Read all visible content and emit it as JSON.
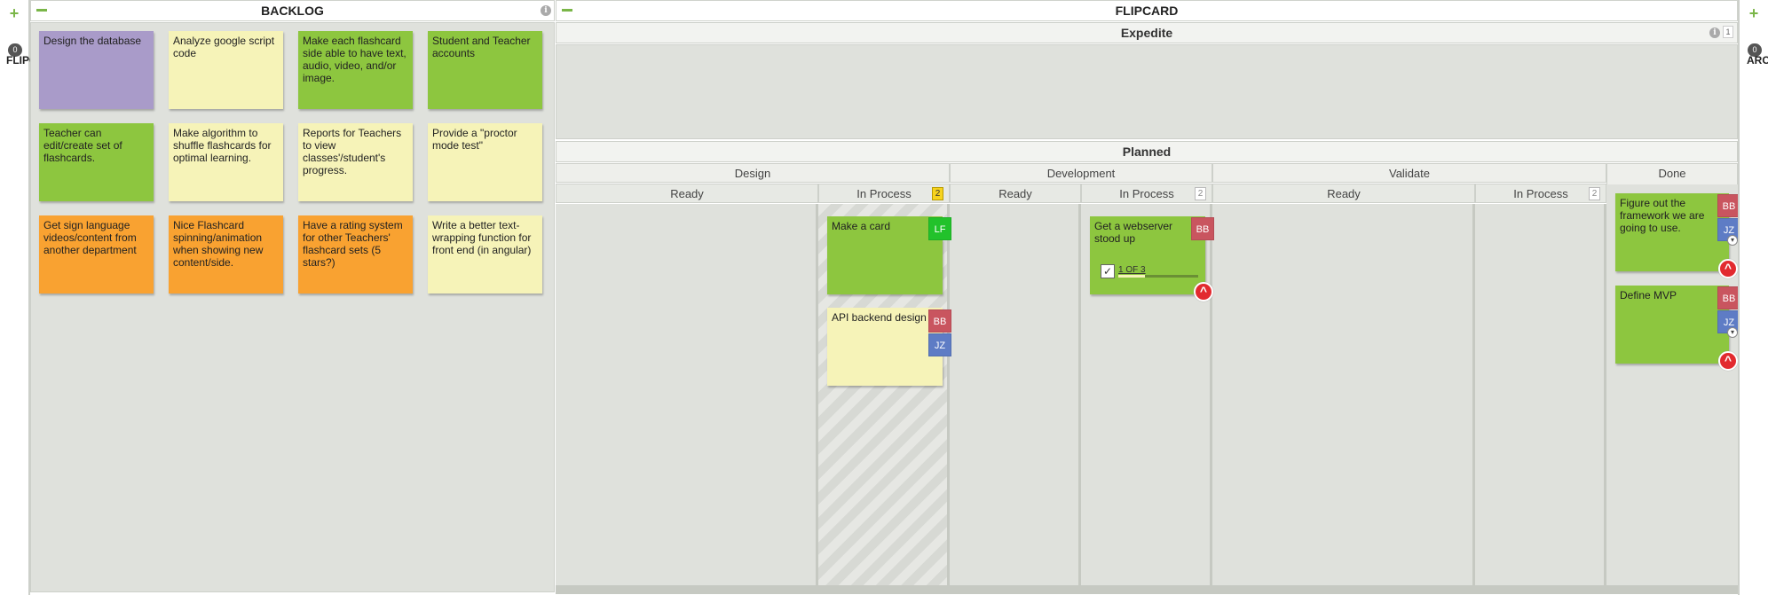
{
  "left_side": {
    "count": "0",
    "label": "FLIPC"
  },
  "right_side": {
    "count": "0",
    "label": "ARC"
  },
  "backlog": {
    "title": "BACKLOG",
    "cards": [
      {
        "text": "Design the database",
        "color": "purple"
      },
      {
        "text": "Analyze google script code",
        "color": "yellow"
      },
      {
        "text": "Make each flashcard side able to have text, audio, video, and/or image.",
        "color": "green"
      },
      {
        "text": "Student and Teacher accounts",
        "color": "green"
      },
      {
        "text": "Teacher can edit/create set of flashcards.",
        "color": "green"
      },
      {
        "text": "Make algorithm to shuffle flashcards for optimal learning.",
        "color": "yellow"
      },
      {
        "text": "Reports for Teachers to view classes'/student's progress.",
        "color": "yellow"
      },
      {
        "text": "Provide a \"proctor mode test\"",
        "color": "yellow"
      },
      {
        "text": "Get sign language videos/content from another department",
        "color": "orange"
      },
      {
        "text": "Nice Flashcard spinning/animation when showing new content/side.",
        "color": "orange"
      },
      {
        "text": "Have a rating system for other Teachers' flashcard sets (5 stars?)",
        "color": "orange"
      },
      {
        "text": "Write a better text-wrapping function for front end (in angular)",
        "color": "yellow"
      }
    ]
  },
  "flipcard": {
    "title": "FLIPCARD",
    "expedite": {
      "title": "Expedite",
      "count": "1"
    },
    "planned": {
      "title": "Planned"
    },
    "groups": {
      "design": "Design",
      "development": "Development",
      "validate": "Validate",
      "done": "Done"
    },
    "subcols": {
      "design_ready": "Ready",
      "design_inprocess": "In Process",
      "design_wip": "2",
      "dev_ready": "Ready",
      "dev_inprocess": "In Process",
      "dev_wip": "2",
      "val_ready": "Ready",
      "val_inprocess": "In Process",
      "val_wip": "2"
    },
    "cards": {
      "make_card": {
        "text": "Make a card",
        "user": "LF"
      },
      "api": {
        "text": "API backend design",
        "user1": "BB",
        "user2": "JZ"
      },
      "webserver": {
        "text": "Get a webserver stood up",
        "user": "BB",
        "progress_text": "1 OF 3",
        "progress": 0.33
      },
      "figure": {
        "text": "Figure out the framework we are going to use.",
        "user1": "BB",
        "user2": "JZ"
      },
      "mvp": {
        "text": "Define MVP",
        "user1": "BB",
        "user2": "JZ"
      }
    }
  },
  "colors": {
    "accent": "#7ab648",
    "green": "#8dc63f",
    "yellow": "#f6f3b8",
    "orange": "#f9a231",
    "purple": "#a99bc9",
    "bb": "#c9555f",
    "jz": "#5e7cc5",
    "lf": "#22c22b"
  }
}
